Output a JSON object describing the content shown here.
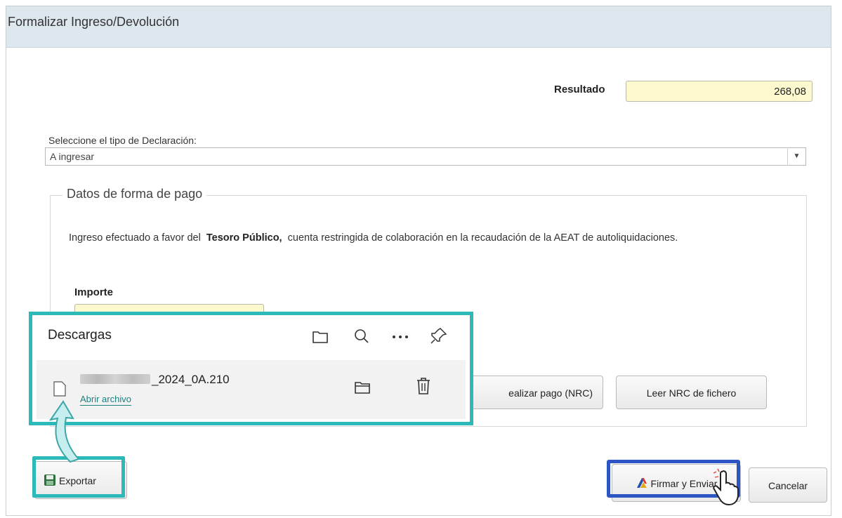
{
  "window": {
    "title": "Formalizar Ingreso/Devolución"
  },
  "resultado": {
    "label": "Resultado",
    "value": "268,08"
  },
  "declaracion": {
    "label": "Seleccione el tipo de Declaración:",
    "selected": "A ingresar"
  },
  "forma_pago": {
    "legend": "Datos de forma de pago",
    "text_prefix": "Ingreso efectuado a favor del",
    "text_bold": "Tesoro Público,",
    "text_suffix": "cuenta restringida de colaboración en la recaudación de la AEAT de autoliquidaciones.",
    "importe_label": "Importe",
    "buttons": {
      "nrc": "ealizar pago (NRC)",
      "leer": "Leer NRC de fichero"
    }
  },
  "downloads": {
    "title": "Descargas",
    "item": {
      "filename_suffix": "_2024_0A.210",
      "open_link": "Abrir archivo"
    }
  },
  "footer": {
    "exportar": "Exportar",
    "firmar": "Firmar y Enviar",
    "cancelar": "Cancelar"
  },
  "colors": {
    "highlight_teal": "#2bb9b9",
    "highlight_blue": "#2e55c4",
    "yellow_field": "#fdf9cf"
  }
}
